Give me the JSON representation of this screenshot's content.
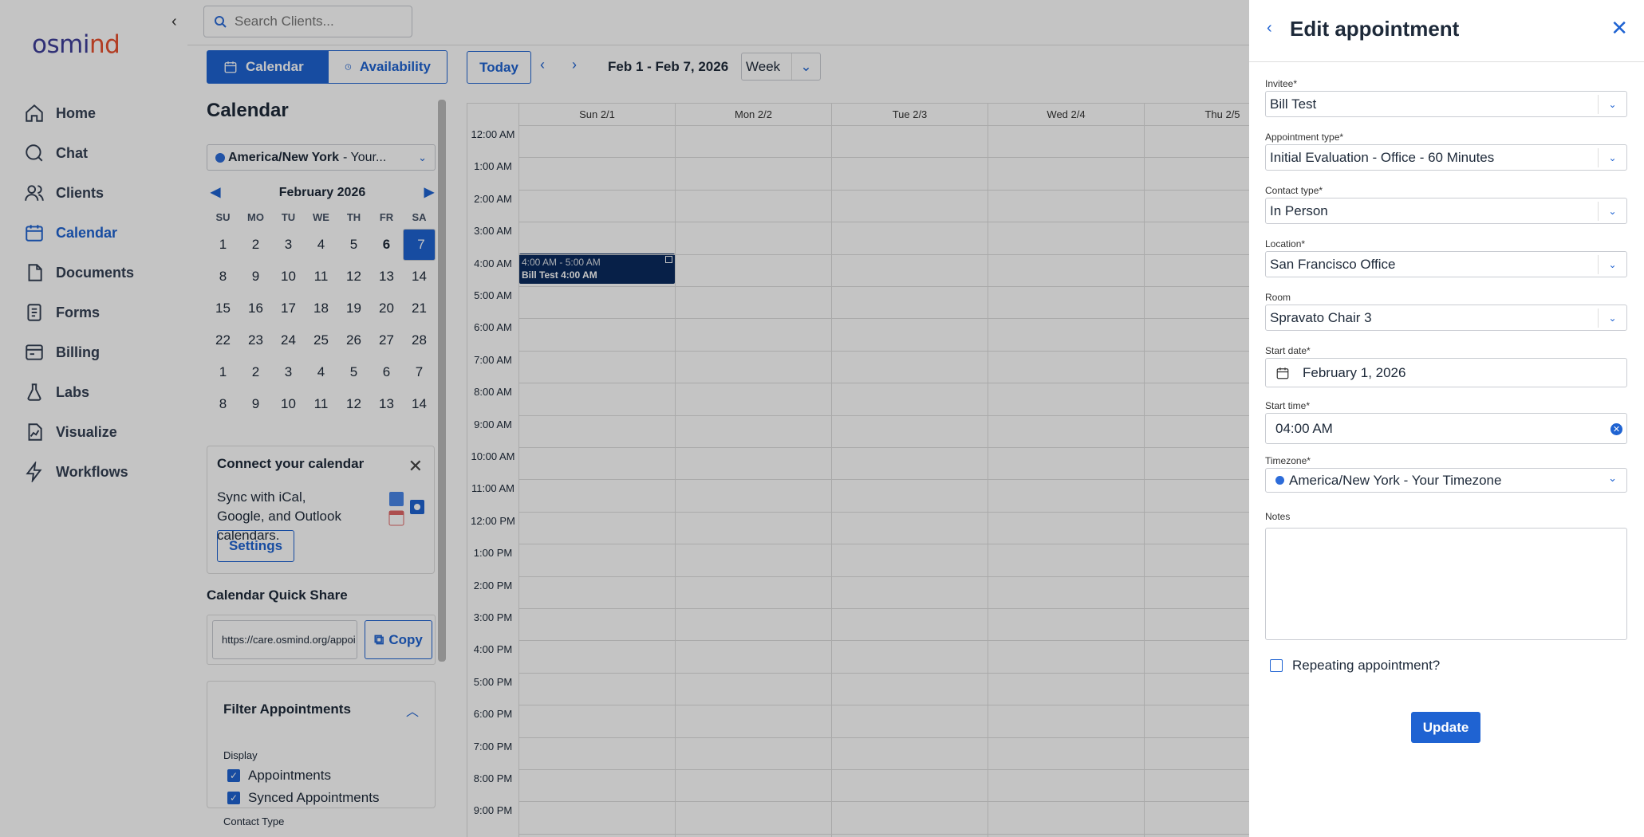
{
  "brand": {
    "logo_main": "osmi",
    "logo_accent": "nd"
  },
  "sidebar": {
    "items": [
      {
        "label": "Home",
        "icon": "home-icon"
      },
      {
        "label": "Chat",
        "icon": "chat-icon"
      },
      {
        "label": "Clients",
        "icon": "clients-icon"
      },
      {
        "label": "Calendar",
        "icon": "calendar-icon",
        "active": true
      },
      {
        "label": "Documents",
        "icon": "documents-icon"
      },
      {
        "label": "Forms",
        "icon": "forms-icon"
      },
      {
        "label": "Billing",
        "icon": "billing-icon"
      },
      {
        "label": "Labs",
        "icon": "labs-icon"
      },
      {
        "label": "Visualize",
        "icon": "visualize-icon"
      },
      {
        "label": "Workflows",
        "icon": "workflows-icon"
      }
    ]
  },
  "search": {
    "placeholder": "Search Clients..."
  },
  "toolbar": {
    "calendar_tab": "Calendar",
    "availability_tab": "Availability",
    "today": "Today",
    "range": "Feb 1 - Feb 7, 2026",
    "view": "Week"
  },
  "left": {
    "title": "Calendar",
    "timezone_bold": "America/New York",
    "timezone_rest": "- Your...",
    "month": "February 2026",
    "dow": [
      "SU",
      "MO",
      "TU",
      "WE",
      "TH",
      "FR",
      "SA"
    ],
    "days": [
      [
        "1",
        "2",
        "3",
        "4",
        "5",
        "6",
        "7"
      ],
      [
        "8",
        "9",
        "10",
        "11",
        "12",
        "13",
        "14"
      ],
      [
        "15",
        "16",
        "17",
        "18",
        "19",
        "20",
        "21"
      ],
      [
        "22",
        "23",
        "24",
        "25",
        "26",
        "27",
        "28"
      ],
      [
        "1",
        "2",
        "3",
        "4",
        "5",
        "6",
        "7"
      ],
      [
        "8",
        "9",
        "10",
        "11",
        "12",
        "13",
        "14"
      ]
    ],
    "connect_title": "Connect your calendar",
    "connect_text": "Sync with iCal, Google, and Outlook calendars.",
    "connect_button": "Settings",
    "quickshare_title": "Calendar Quick Share",
    "quickshare_url": "https://care.osmind.org/appoi",
    "copy": "Copy",
    "filter_title": "Filter Appointments",
    "display_label": "Display",
    "filter_items": [
      "Appointments",
      "Synced Appointments"
    ],
    "contact_type_label": "Contact Type"
  },
  "week": {
    "days": [
      "Sun 2/1",
      "Mon 2/2",
      "Tue 2/3",
      "Wed 2/4",
      "Thu 2/5"
    ],
    "times": [
      "12:00 AM",
      "1:00 AM",
      "2:00 AM",
      "3:00 AM",
      "4:00 AM",
      "5:00 AM",
      "6:00 AM",
      "7:00 AM",
      "8:00 AM",
      "9:00 AM",
      "10:00 AM",
      "11:00 AM",
      "12:00 PM",
      "1:00 PM",
      "2:00 PM",
      "3:00 PM",
      "4:00 PM",
      "5:00 PM",
      "6:00 PM",
      "7:00 PM",
      "8:00 PM",
      "9:00 PM"
    ],
    "event_time": "4:00 AM - 5:00 AM",
    "event_title": "Bill Test 4:00 AM"
  },
  "drawer": {
    "title": "Edit appointment",
    "invitee_label": "Invitee*",
    "invitee": "Bill Test",
    "apptype_label": "Appointment type*",
    "apptype": "Initial Evaluation - Office - 60 Minutes",
    "contact_label": "Contact type*",
    "contact": "In Person",
    "location_label": "Location*",
    "location": "San Francisco Office",
    "room_label": "Room",
    "room": "Spravato Chair 3",
    "startdate_label": "Start date*",
    "startdate": "February 1, 2026",
    "starttime_label": "Start time*",
    "starttime": "04:00 AM",
    "timezone_label": "Timezone*",
    "timezone": "America/New York - Your Timezone",
    "notes_label": "Notes",
    "repeat_label": "Repeating appointment?",
    "update": "Update"
  },
  "colors": {
    "accent": "#1f63d2",
    "event": "#0a2a5e",
    "logo_accent": "#e8502e"
  }
}
